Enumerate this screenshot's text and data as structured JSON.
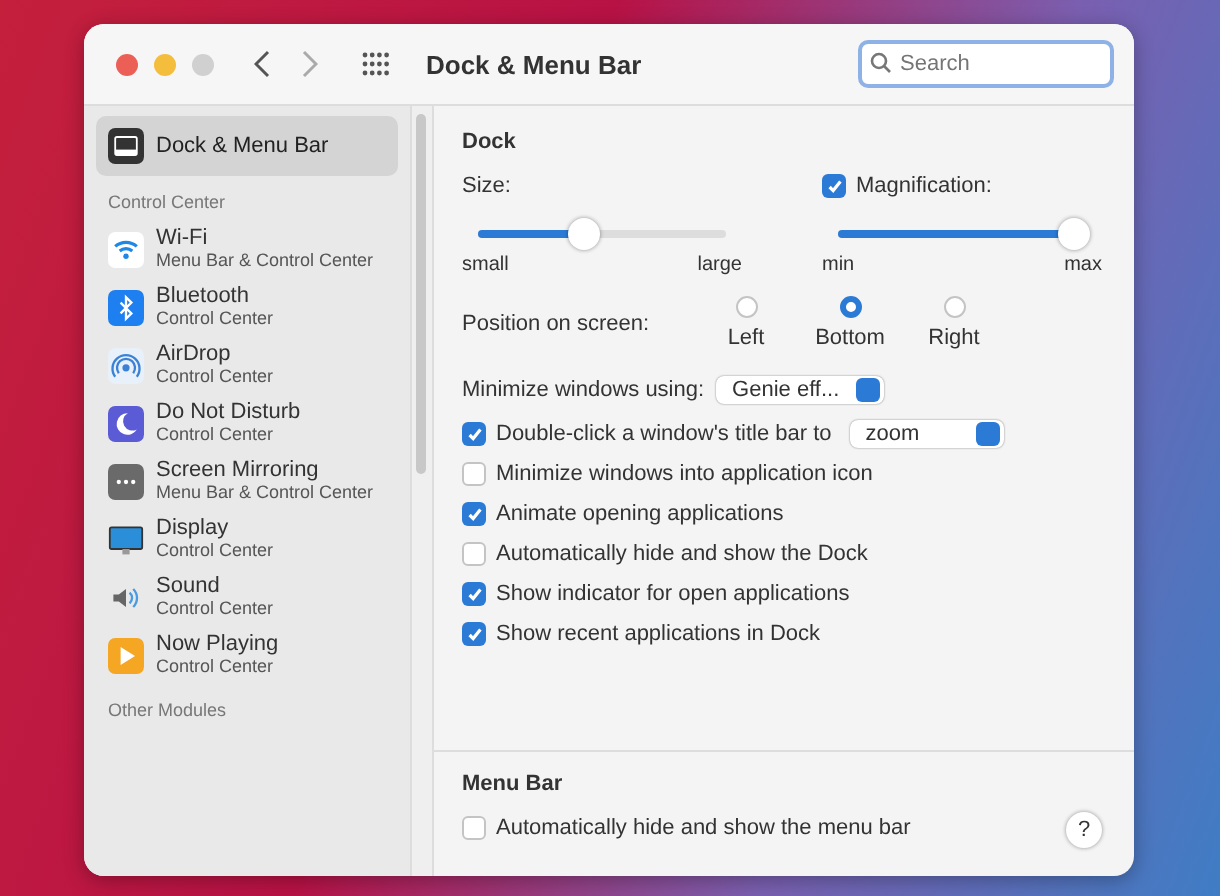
{
  "window": {
    "title": "Dock & Menu Bar"
  },
  "search": {
    "placeholder": "Search"
  },
  "sidebar": {
    "selected_item": {
      "label": "Dock & Menu Bar",
      "selected": true
    },
    "sections": [
      {
        "heading": "Control Center",
        "items": [
          {
            "kind": "wifi",
            "label": "Wi-Fi",
            "sublabel": "Menu Bar & Control Center",
            "selected": false
          },
          {
            "kind": "bluetooth",
            "label": "Bluetooth",
            "sublabel": "Control Center",
            "selected": false
          },
          {
            "kind": "airdrop",
            "label": "AirDrop",
            "sublabel": "Control Center",
            "selected": false
          },
          {
            "kind": "moon",
            "label": "Do Not Disturb",
            "sublabel": "Control Center",
            "selected": false
          },
          {
            "kind": "mirror",
            "label": "Screen Mirroring",
            "sublabel": "Menu Bar & Control Center",
            "selected": false
          },
          {
            "kind": "display",
            "label": "Display",
            "sublabel": "Control Center",
            "selected": false
          },
          {
            "kind": "sound",
            "label": "Sound",
            "sublabel": "Control Center",
            "selected": false
          },
          {
            "kind": "play",
            "label": "Now Playing",
            "sublabel": "Control Center",
            "selected": false
          }
        ]
      },
      {
        "heading": "Other Modules"
      }
    ]
  },
  "dock": {
    "heading": "Dock",
    "size": {
      "label": "Size:",
      "level": 0.43,
      "min": "small",
      "max": "large"
    },
    "magnification": {
      "label": "Magnification:",
      "checked": true,
      "level": 0.95,
      "min": "min",
      "max": "max"
    },
    "position": {
      "label": "Position on screen:",
      "options": [
        {
          "label": "Left",
          "selected": false
        },
        {
          "label": "Bottom",
          "selected": true
        },
        {
          "label": "Right",
          "selected": false
        }
      ]
    },
    "minimize": {
      "label": "Minimize windows using:",
      "value": "Genie eff..."
    },
    "double_click": {
      "label": "Double-click a window's title bar to",
      "checked": true,
      "value": "zoom"
    },
    "options": [
      {
        "label": "Minimize windows into application icon",
        "checked": false
      },
      {
        "label": "Animate opening applications",
        "checked": true
      },
      {
        "label": "Automatically hide and show the Dock",
        "checked": false
      },
      {
        "label": "Show indicator for open applications",
        "checked": true
      },
      {
        "label": "Show recent applications in Dock",
        "checked": true
      }
    ]
  },
  "menu_bar": {
    "heading": "Menu Bar",
    "options": [
      {
        "label": "Automatically hide and show the menu bar",
        "checked": false
      }
    ]
  },
  "help": "?"
}
